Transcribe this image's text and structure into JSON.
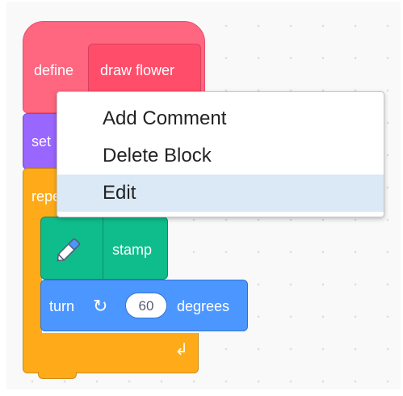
{
  "define_block": {
    "keyword": "define",
    "procedure_name": "draw flower"
  },
  "set_block": {
    "label": "set"
  },
  "repeat_block": {
    "label": "repe"
  },
  "stamp_block": {
    "label": "stamp",
    "icon": "pen-icon"
  },
  "turn_block": {
    "label": "turn",
    "icon": "rotate-clockwise-icon",
    "value": "60",
    "unit": "degrees"
  },
  "context_menu": {
    "items": [
      {
        "label": "Add Comment",
        "highlighted": false
      },
      {
        "label": "Delete Block",
        "highlighted": false
      },
      {
        "label": "Edit",
        "highlighted": true
      }
    ]
  },
  "colors": {
    "events_pink": "#ff6680",
    "looks_purple": "#9966ff",
    "control_orange": "#ffab19",
    "pen_green": "#0fbd8c",
    "motion_blue": "#4c97ff",
    "menu_highlight": "#dbe9f6"
  }
}
